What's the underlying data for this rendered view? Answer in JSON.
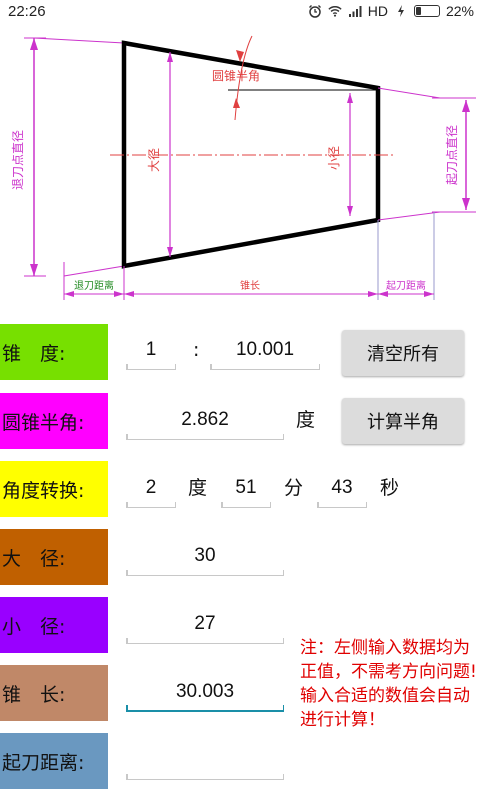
{
  "status_bar": {
    "time": "22:26",
    "network": "HD",
    "battery": "22%",
    "battery_level": 0.22
  },
  "diagram": {
    "label_cone_half_angle": "圆锥半角",
    "label_big_diameter": "大径",
    "label_small_diameter": "小径",
    "label_retract_point_diameter": "退刀点直径",
    "label_start_point_diameter": "起刀点直径",
    "label_retract_distance": "退刀距离",
    "label_cone_length": "锥长",
    "label_start_distance": "起刀距离"
  },
  "form": {
    "taper": {
      "label": "锥　度:",
      "left_value": "1",
      "colon": ":",
      "right_value": "10.001",
      "color": "#77e000"
    },
    "half_angle": {
      "label": "圆锥半角:",
      "value": "2.862",
      "unit": "度",
      "color": "#ff00ff"
    },
    "angle_convert": {
      "label": "角度转换:",
      "deg_value": "2",
      "deg_unit": "度",
      "min_value": "51",
      "min_unit": "分",
      "sec_value": "43",
      "sec_unit": "秒",
      "color": "#ffff00"
    },
    "big_diameter": {
      "label": "大　径:",
      "value": "30",
      "color": "#c06000"
    },
    "small_diameter": {
      "label": "小　径:",
      "value": "27",
      "color": "#9900ff"
    },
    "cone_length": {
      "label": "锥　长:",
      "value": "30.003",
      "color": "#c08868"
    },
    "start_distance": {
      "label": "起刀距离:",
      "value": "",
      "color": "#6a98c0"
    }
  },
  "buttons": {
    "clear_all": "清空所有",
    "calc_half_angle": "计算半角"
  },
  "note": "注：左侧输入数据均为正值，不需考方向问题!输入合适的数值会自动进行计算！"
}
